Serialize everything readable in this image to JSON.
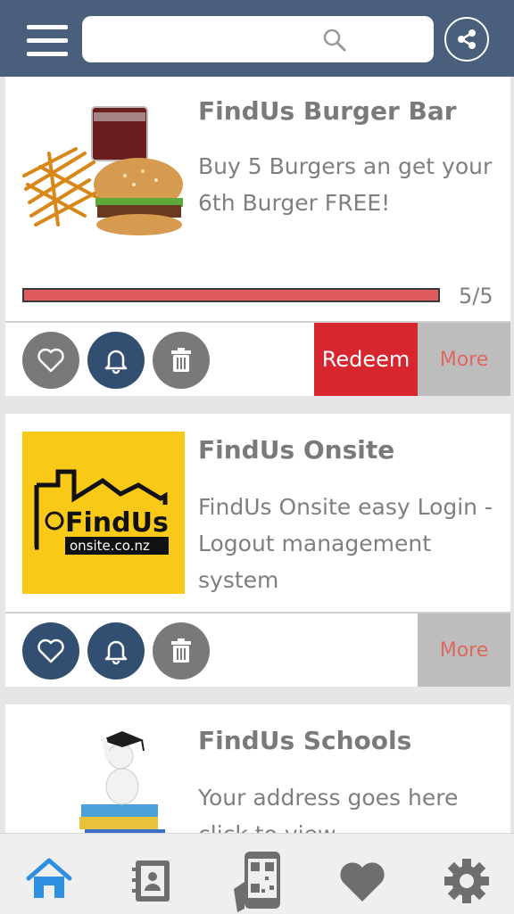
{
  "header": {
    "search_placeholder": "",
    "icons": [
      "menu-icon",
      "search-icon",
      "share-icon"
    ]
  },
  "cards": [
    {
      "title": "FindUs Burger Bar",
      "description": "Buy 5 Burgers an get your 6th Burger FREE!",
      "progress_label": "5/5",
      "progress_fraction": 1.0,
      "redeem_label": "Redeem",
      "more_label": "More",
      "favorite_active": false,
      "notify_active": true
    },
    {
      "title": "FindUs Onsite",
      "description": "FindUs Onsite easy Login - Logout management system",
      "logo_text": "FindUs",
      "logo_url_text": "onsite.co.nz",
      "more_label": "More",
      "favorite_active": true,
      "notify_active": true
    },
    {
      "title": "FindUs Schools",
      "description": "Your address goes here click to view"
    }
  ],
  "bottom_nav": {
    "items": [
      "home-icon",
      "contacts-icon",
      "qr-scan-icon",
      "favorites-icon",
      "settings-icon"
    ],
    "active": "home-icon"
  },
  "colors": {
    "header": "#4a5f7c",
    "redeem": "#d8262f",
    "progress_fill": "#e05b5b",
    "active_circle": "#324f72",
    "inactive_circle": "#797979",
    "active_nav": "#2f8fe0"
  }
}
